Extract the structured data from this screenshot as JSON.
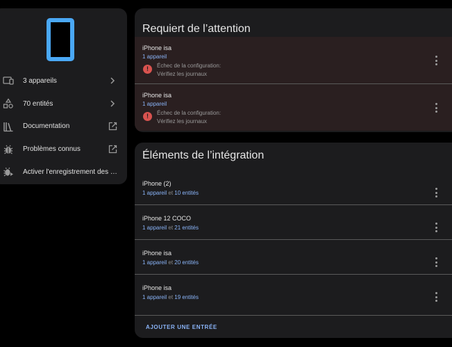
{
  "left_panel": {
    "device_illustration": "phone-illustration",
    "menu": [
      {
        "icon": "devices-icon",
        "label": "3 appareils",
        "trail": "chevron-right-icon"
      },
      {
        "icon": "entities-icon",
        "label": "70 entités",
        "trail": "chevron-right-icon"
      },
      {
        "icon": "book-icon",
        "label": "Documentation",
        "trail": "open-in-new-icon"
      },
      {
        "icon": "bug-icon",
        "label": "Problèmes connus",
        "trail": "open-in-new-icon"
      },
      {
        "icon": "bug-play-icon",
        "label": "Activer l'enregistrement des jo..."
      }
    ]
  },
  "attention": {
    "title": "Requiert de l’attention",
    "items": [
      {
        "name": "iPhone isa",
        "devices": "1 appareil",
        "error_line1": "Échec de la configuration:",
        "error_line2": "Vérifiez les journaux"
      },
      {
        "name": "iPhone isa",
        "devices": "1 appareil",
        "error_line1": "Échec de la configuration:",
        "error_line2": "Vérifiez les journaux"
      }
    ]
  },
  "integration": {
    "title": "Éléments de l’intégration",
    "conjunction": "et",
    "items": [
      {
        "name": "iPhone (2)",
        "devices": "1 appareil",
        "entities": "10 entités"
      },
      {
        "name": "iPhone 12 COCO",
        "devices": "1 appareil",
        "entities": "21 entités"
      },
      {
        "name": "iPhone isa",
        "devices": "1 appareil",
        "entities": "20 entités"
      },
      {
        "name": "iPhone isa",
        "devices": "1 appareil",
        "entities": "19 entités"
      }
    ],
    "add_entry_label": "AJOUTER UNE ENTRÉE"
  },
  "colors": {
    "background": "#000000",
    "card": "#1c1c1e",
    "accent_link": "#8ab4f8",
    "error": "#d9534f",
    "attention_row": "#2a1f20",
    "device_icon": "#4aa8f5"
  }
}
